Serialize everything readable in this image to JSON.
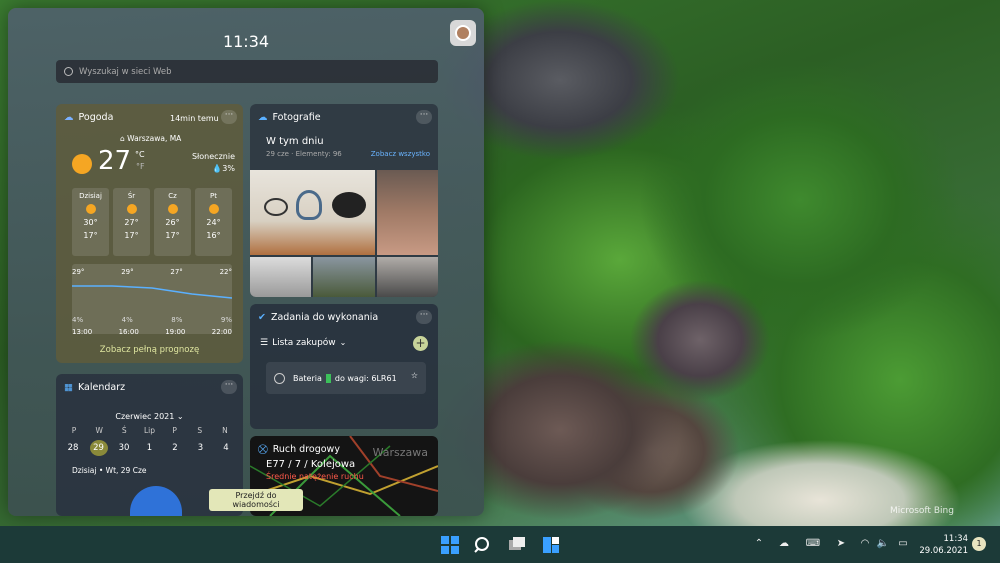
{
  "clock": "11:34",
  "search": {
    "placeholder": "Wyszukaj w sieci Web"
  },
  "weather": {
    "title": "Pogoda",
    "updated": "14min temu",
    "location": "Warszawa, MA",
    "temp": "27",
    "unit_c": "°C",
    "unit_f": "°F",
    "condition": "Słonecznie",
    "precip": "3%",
    "days": [
      {
        "name": "Dzisiaj",
        "high": "30°",
        "low": "17°"
      },
      {
        "name": "Śr",
        "high": "27°",
        "low": "17°"
      },
      {
        "name": "Cz",
        "high": "26°",
        "low": "17°"
      },
      {
        "name": "Pt",
        "high": "24°",
        "low": "16°"
      }
    ],
    "hourly": {
      "temps": [
        "29°",
        "29°",
        "27°",
        "22°"
      ],
      "precip": [
        "4%",
        "4%",
        "8%",
        "9%"
      ],
      "times": [
        "13:00",
        "16:00",
        "19:00",
        "22:00"
      ]
    },
    "link": "Zobacz pełną prognozę"
  },
  "photos": {
    "title": "Fotografie",
    "subtitle": "W tym dniu",
    "meta": "29 cze · Elementy: 96",
    "link": "Zobacz wszystko"
  },
  "tasks": {
    "title": "Zadania do wykonania",
    "list": "Lista zakupów",
    "item_prefix": "Bateria",
    "item_suffix": "do wagi: 6LR61"
  },
  "calendar": {
    "title": "Kalendarz",
    "month": "Czerwiec 2021",
    "weekdays": [
      "P",
      "W",
      "Ś",
      "Lip",
      "P",
      "S",
      "N"
    ],
    "dates": [
      "28",
      "29",
      "30",
      "1",
      "2",
      "3",
      "4"
    ],
    "today": "Dzisiaj • Wt, 29 Cze"
  },
  "traffic": {
    "title": "Ruch drogowy",
    "route": "E77 / 7 / Kolejowa",
    "status": "Średnie natężenie ruchu",
    "map_label": "Warszawa"
  },
  "news_button": "Przejdź do wiadomości",
  "bing": "Microsoft Bing",
  "tray": {
    "time": "11:34",
    "date": "29.06.2021",
    "badge": "1"
  },
  "colors": {
    "accent": "#3a8be6",
    "sun": "#f5a623",
    "calendar_today": "#8a8a3a",
    "traffic_status": "#ff5a4a"
  }
}
